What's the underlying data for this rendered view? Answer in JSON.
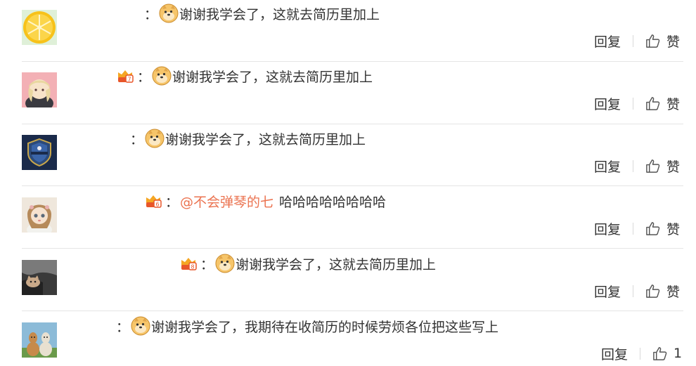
{
  "comments": [
    {
      "avatar": "lemon-slice-avatar",
      "has_badge": false,
      "colon": "：",
      "mention": "",
      "text": "谢谢我学会了，这就去简历里加上",
      "reply_label": "回复",
      "like_label": "赞"
    },
    {
      "avatar": "anime-girl-avatar",
      "has_badge": true,
      "colon": "：",
      "mention": "",
      "text": "谢谢我学会了，这就去简历里加上",
      "reply_label": "回复",
      "like_label": "赞"
    },
    {
      "avatar": "shield-logo-avatar",
      "has_badge": false,
      "colon": "：",
      "mention": "",
      "text": "谢谢我学会了，这就去简历里加上",
      "reply_label": "回复",
      "like_label": "赞"
    },
    {
      "avatar": "doll-avatar",
      "has_badge": true,
      "colon": "：",
      "mention": "@不会弹琴的七",
      "text": "哈哈哈哈哈哈哈哈",
      "reply_label": "回复",
      "like_label": "赞"
    },
    {
      "avatar": "cat-photo-avatar",
      "has_badge": true,
      "colon": "：",
      "mention": "",
      "text": "谢谢我学会了，这就去简历里加上",
      "reply_label": "回复",
      "like_label": "赞"
    },
    {
      "avatar": "alpaca-avatar",
      "has_badge": false,
      "colon": "：",
      "mention": "",
      "text": "谢谢我学会了，我期待在收简历的时候劳烦各位把这些写上",
      "reply_label": "回复",
      "like_label": "1"
    }
  ],
  "colors": {
    "mention": "#eb7350",
    "text": "#333333",
    "divider": "#e5e5e5"
  }
}
